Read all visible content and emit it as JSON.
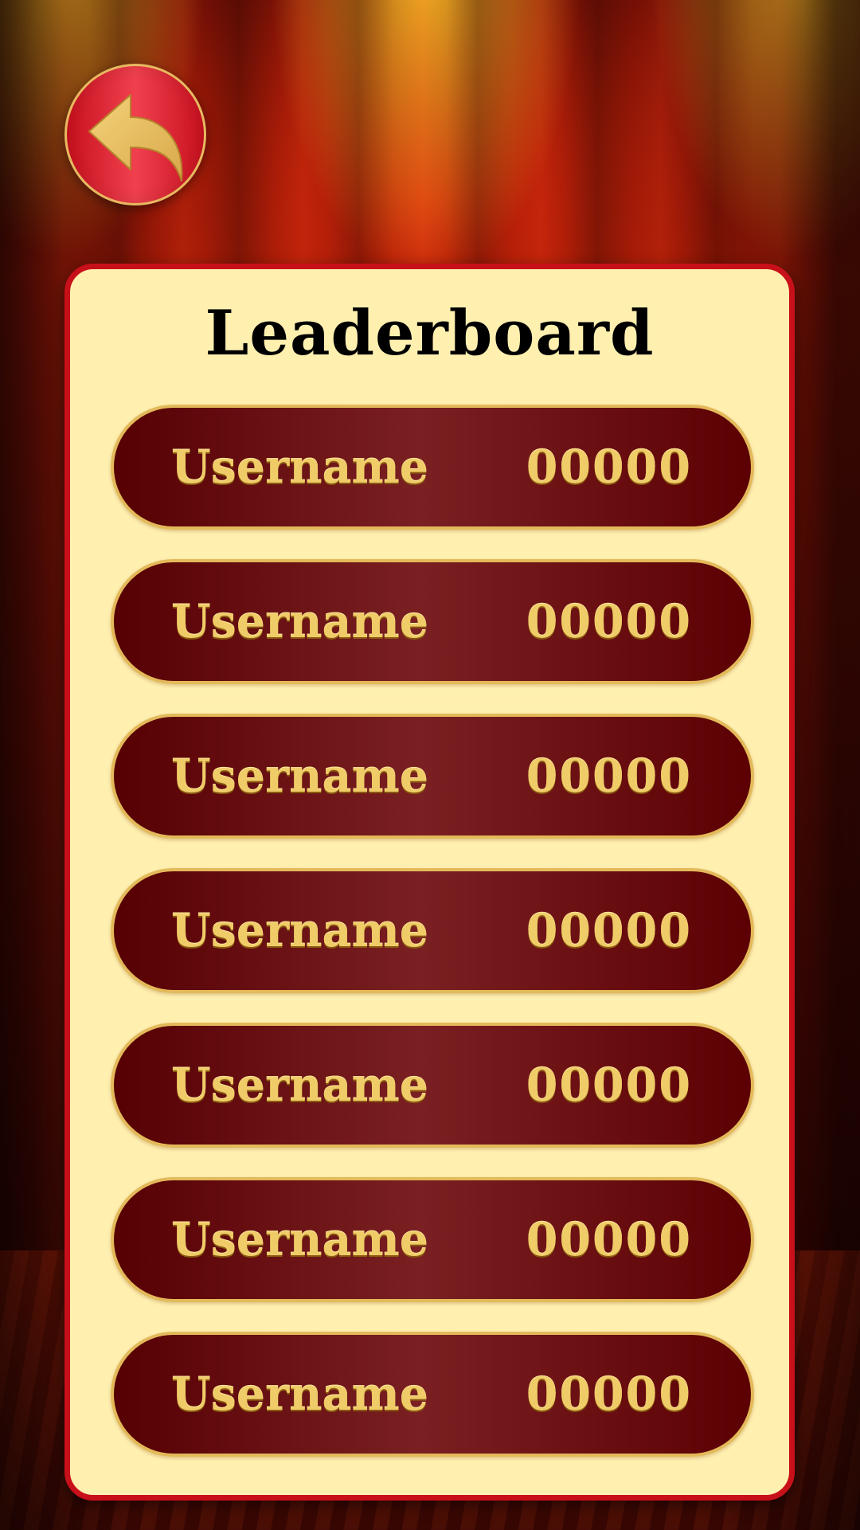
{
  "back_button": {
    "icon": "back-arrow-icon"
  },
  "leaderboard": {
    "title": "Leaderboard",
    "rows": [
      {
        "name": "Username",
        "score": "00000"
      },
      {
        "name": "Username",
        "score": "00000"
      },
      {
        "name": "Username",
        "score": "00000"
      },
      {
        "name": "Username",
        "score": "00000"
      },
      {
        "name": "Username",
        "score": "00000"
      },
      {
        "name": "Username",
        "score": "00000"
      },
      {
        "name": "Username",
        "score": "00000"
      }
    ]
  },
  "colors": {
    "panel_background": "#fff0b0",
    "panel_border": "#c8101a",
    "row_background": "#6a1012",
    "row_border": "#e3b95a",
    "row_text": "#f0cc68",
    "button_red": "#e23040"
  }
}
